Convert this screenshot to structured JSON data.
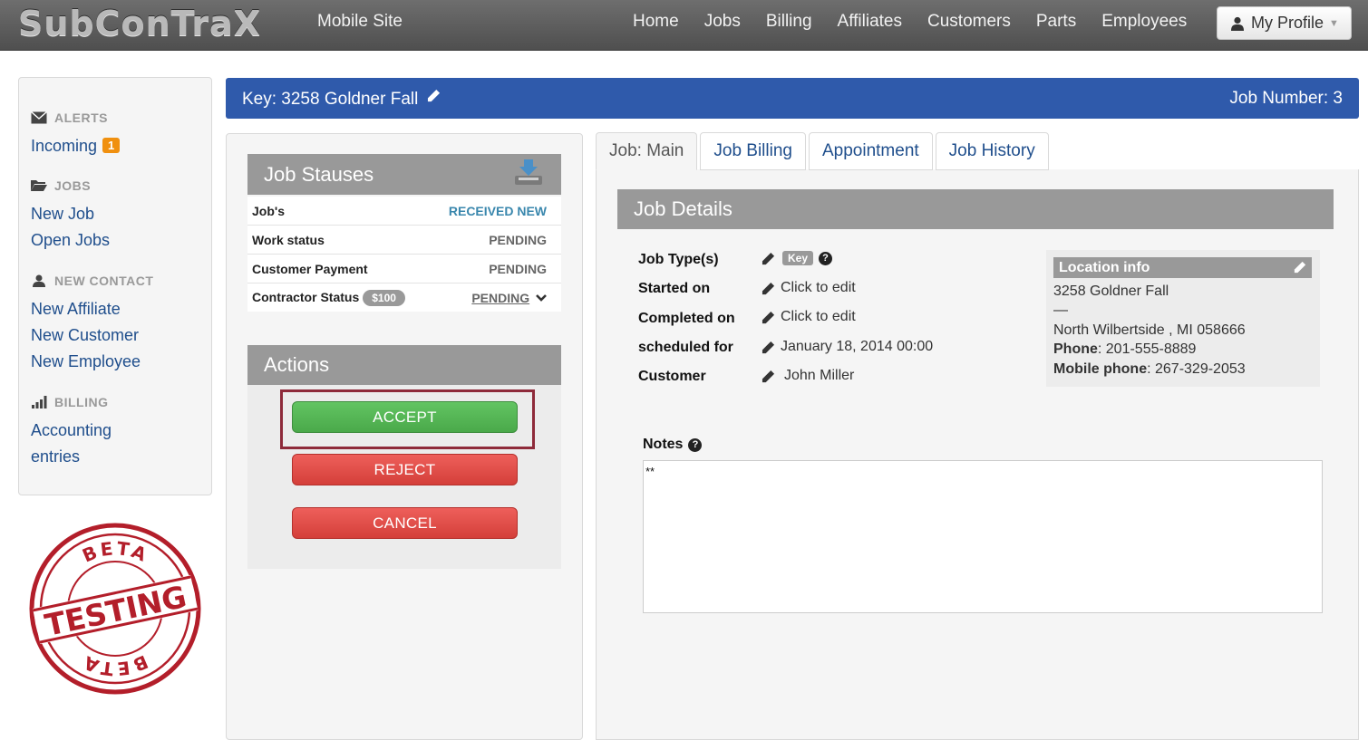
{
  "navbar": {
    "brand": "SubConTraX",
    "mobile_site": "Mobile Site",
    "links": [
      "Home",
      "Jobs",
      "Billing",
      "Affiliates",
      "Customers",
      "Parts",
      "Employees"
    ],
    "profile": "My Profile"
  },
  "sidebar": {
    "alerts_header": "ALERTS",
    "incoming": "Incoming",
    "incoming_count": "1",
    "jobs_header": "JOBS",
    "new_job": "New Job",
    "open_jobs": "Open Jobs",
    "contact_header": "NEW CONTACT",
    "new_affiliate": "New Affiliate",
    "new_customer": "New Customer",
    "new_employee": "New Employee",
    "billing_header": "BILLING",
    "accounting": "Accounting",
    "entries": "entries"
  },
  "stamp": {
    "top": "BETA",
    "middle": "TESTING",
    "bottom": "BETA"
  },
  "keybar": {
    "key": "Key: 3258 Goldner Fall",
    "job_number": "Job Number: 3"
  },
  "statuses": {
    "title": "Job Stauses",
    "rows": [
      {
        "label": "Job's",
        "value": "RECEIVED NEW"
      },
      {
        "label": "Work status",
        "value": "PENDING"
      },
      {
        "label": "Customer Payment",
        "value": "PENDING"
      },
      {
        "label": "Contractor Status",
        "badge": "$100",
        "value": "PENDING"
      }
    ]
  },
  "actions": {
    "title": "Actions",
    "accept": "ACCEPT",
    "reject": "REJECT",
    "cancel": "CANCEL"
  },
  "tabs": [
    "Job: Main",
    "Job Billing",
    "Appointment",
    "Job History"
  ],
  "job_details": {
    "title": "Job Details",
    "type_label": "Job Type(s)",
    "type_tag": "Key",
    "started_label": "Started on",
    "started_value": "Click to edit",
    "completed_label": "Completed on",
    "completed_value": "Click to edit",
    "scheduled_label": "scheduled for",
    "scheduled_value": "January 18, 2014 00:00",
    "customer_label": "Customer",
    "customer_value": "John Miller"
  },
  "location": {
    "title": "Location info",
    "street": "3258 Goldner Fall",
    "dash": "—",
    "city": "North Wilbertside , MI 058666",
    "phone_label": "Phone",
    "phone": ": 201-555-8889",
    "mobile_label": "Mobile phone",
    "mobile": ": 267-329-2053"
  },
  "notes": {
    "label": "Notes",
    "value": "**"
  },
  "colors": {
    "navbar": "#5e5e5e",
    "keybar": "#2f5aab",
    "accept": "#5cb85c",
    "reject": "#d9534f",
    "link": "#1f4e8c",
    "alert_badge": "#f0900f",
    "highlight": "#8e2a3a"
  }
}
